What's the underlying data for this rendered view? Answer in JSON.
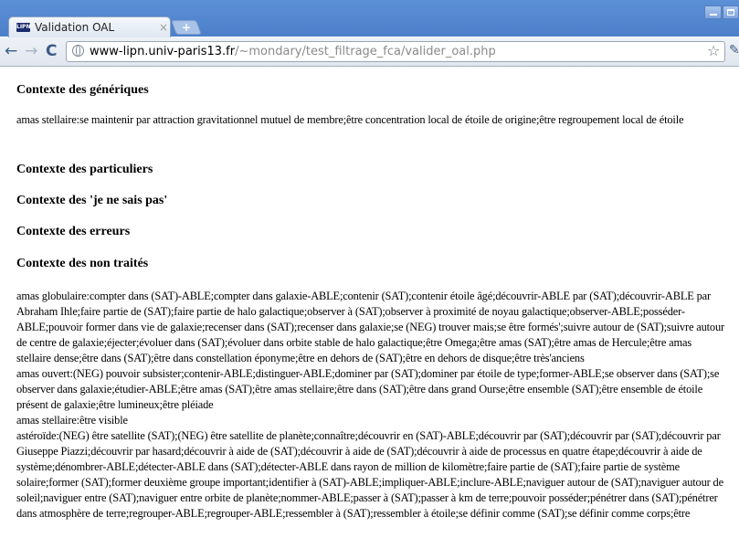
{
  "browser": {
    "tab_title": "Validation OAL",
    "tab_favicon_text": "LIPN",
    "tab_close": "×",
    "new_tab": "+",
    "url_host": "www-lipn.univ-paris13.fr",
    "url_path": "/~mondary/test_filtrage_fca/valider_oal.php",
    "back": "←",
    "forward": "→",
    "reload": "C",
    "star": "☆",
    "wrench": "🔧"
  },
  "page": {
    "section_generiques": "Contexte des génériques",
    "generiques_text": "amas stellaire:se maintenir par attraction gravitationnel mutuel de membre;être concentration local de étoile de origine;être regroupement local de étoile",
    "section_particuliers": "Contexte des particuliers",
    "section_nsp": "Contexte des 'je ne sais pas'",
    "section_erreurs": "Contexte des erreurs",
    "section_non_traites": "Contexte des non traités",
    "non_traites": [
      "amas globulaire:compter dans (SAT)-ABLE;compter dans galaxie-ABLE;contenir (SAT);contenir étoile âgé;découvrir-ABLE par (SAT);découvrir-ABLE par Abraham Ihle;faire partie de (SAT);faire partie de halo galactique;observer à (SAT);observer à proximité de noyau galactique;observer-ABLE;posséder-ABLE;pouvoir former dans vie de galaxie;recenser dans (SAT);recenser dans galaxie;se (NEG) trouver mais;se être formés';suivre autour de (SAT);suivre autour de centre de galaxie;éjecter;évoluer dans (SAT);évoluer dans orbite stable de halo galactique;être Omega;être amas (SAT);être amas de Hercule;être amas stellaire dense;être dans (SAT);être dans constellation éponyme;être en dehors de (SAT);être en dehors de disque;être très'anciens",
      "amas ouvert:(NEG) pouvoir subsister;contenir-ABLE;distinguer-ABLE;dominer par (SAT);dominer par étoile de type;former-ABLE;se observer dans (SAT);se observer dans galaxie;étudier-ABLE;être amas (SAT);être amas stellaire;être dans (SAT);être dans grand Ourse;être ensemble (SAT);être ensemble de étoile présent de galaxie;être lumineux;être pléiade",
      "amas stellaire:être visible",
      "astéroïde:(NEG) être satellite (SAT);(NEG) être satellite de planète;connaître;découvrir en (SAT)-ABLE;découvrir par (SAT);découvrir par (SAT);découvrir par Giuseppe Piazzi;découvrir par hasard;découvrir à aide de (SAT);découvrir à aide de (SAT);découvrir à aide de processus en quatre étape;découvrir à aide de système;dénombrer-ABLE;détecter-ABLE dans (SAT);détecter-ABLE dans rayon de million de kilomètre;faire partie de (SAT);faire partie de système solaire;former (SAT);former deuxième groupe important;identifier à (SAT)-ABLE;impliquer-ABLE;inclure-ABLE;naviguer autour de (SAT);naviguer autour de soleil;naviguer entre (SAT);naviguer entre orbite de planète;nommer-ABLE;passer à (SAT);passer à km de terre;pouvoir posséder;pénétrer dans (SAT);pénétrer dans atmosphère de terre;regrouper-ABLE;regrouper-ABLE;ressembler à (SAT);ressembler à étoile;se définir comme (SAT);se définir comme corps;être"
    ]
  }
}
